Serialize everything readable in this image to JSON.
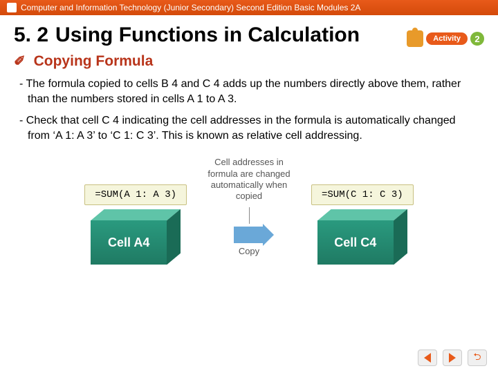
{
  "header": {
    "text": "Computer and Information Technology (Junior Secondary) Second Edition Basic Modules 2A"
  },
  "section": {
    "number": "5. 2",
    "title": "Using Functions in Calculation"
  },
  "activity": {
    "label": "Activity",
    "number": "2"
  },
  "subheading": {
    "icon": "✐",
    "text": "Copying Formula"
  },
  "para1": "- The formula copied to cells B 4 and C 4 adds up the numbers directly above them, rather than the numbers stored in cells A 1 to A 3.",
  "para2": "- Check that cell C 4 indicating the cell addresses in the formula is automatically changed from ‘A 1: A 3’ to ‘C 1: C 3’. This is known as relative cell addressing.",
  "diagram": {
    "callout": "Cell addresses in formula are changed automatically when copied",
    "left": {
      "formula": "=SUM(A 1: A 3)",
      "label": "Cell A4"
    },
    "right": {
      "formula": "=SUM(C 1: C 3)",
      "label": "Cell C4"
    },
    "copy": "Copy"
  }
}
